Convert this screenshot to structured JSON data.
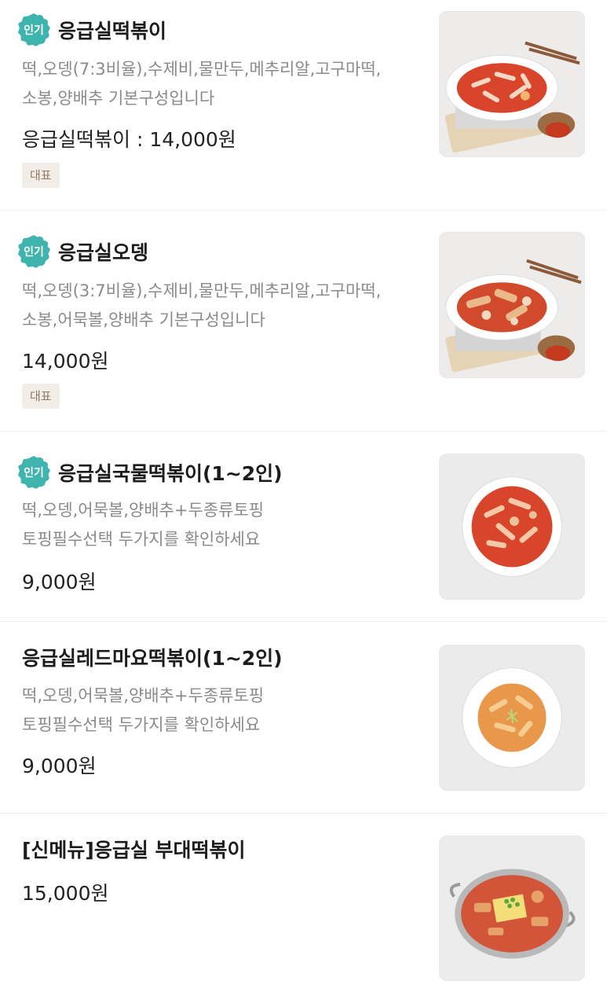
{
  "menu_items": [
    {
      "badge": "인기",
      "title": "응급실떡볶이",
      "desc": [
        "떡,오뎅(7:3비율),수제비,물만두,메추리알,고구마떡,",
        "소봉,양배추 기본구성입니다"
      ],
      "price": "응급실떡볶이 : 14,000원",
      "tag": "대표",
      "image": "tteokbokki-plate-photo"
    },
    {
      "badge": "인기",
      "title": "응급실오뎅",
      "desc": [
        "떡,오뎅(3:7비율),수제비,물만두,메추리알,고구마떡,",
        "소봉,어묵볼,양배추 기본구성입니다"
      ],
      "price": "14,000원",
      "tag": "대표",
      "image": "odeng-plate-photo"
    },
    {
      "badge": "인기",
      "title": "응급실국물떡볶이(1~2인)",
      "desc": [
        "떡,오뎅,어묵볼,양배추+두종류토핑",
        "토핑필수선택 두가지를 확인하세요"
      ],
      "price": "9,000원",
      "image": "soup-tteokbokki-bowl-photo"
    },
    {
      "title": "응급실레드마요떡볶이(1~2인)",
      "desc": [
        "떡,오뎅,어묵볼,양배추+두종류토핑",
        "토핑필수선택 두가지를 확인하세요"
      ],
      "price": "9,000원",
      "image": "redmayo-tteokbokki-bowl-photo"
    },
    {
      "title": "[신메뉴]응급실 부대떡볶이",
      "price": "15,000원",
      "image": "budae-tteokbokki-pan-photo"
    }
  ],
  "colors": {
    "badge": "#3fb3ad",
    "tag_bg": "#f3ede7",
    "tag_text": "#8e7a66",
    "desc_text": "#8a8a8a",
    "sauce_red": "#d9452a",
    "mayo_orange": "#e9974a"
  }
}
